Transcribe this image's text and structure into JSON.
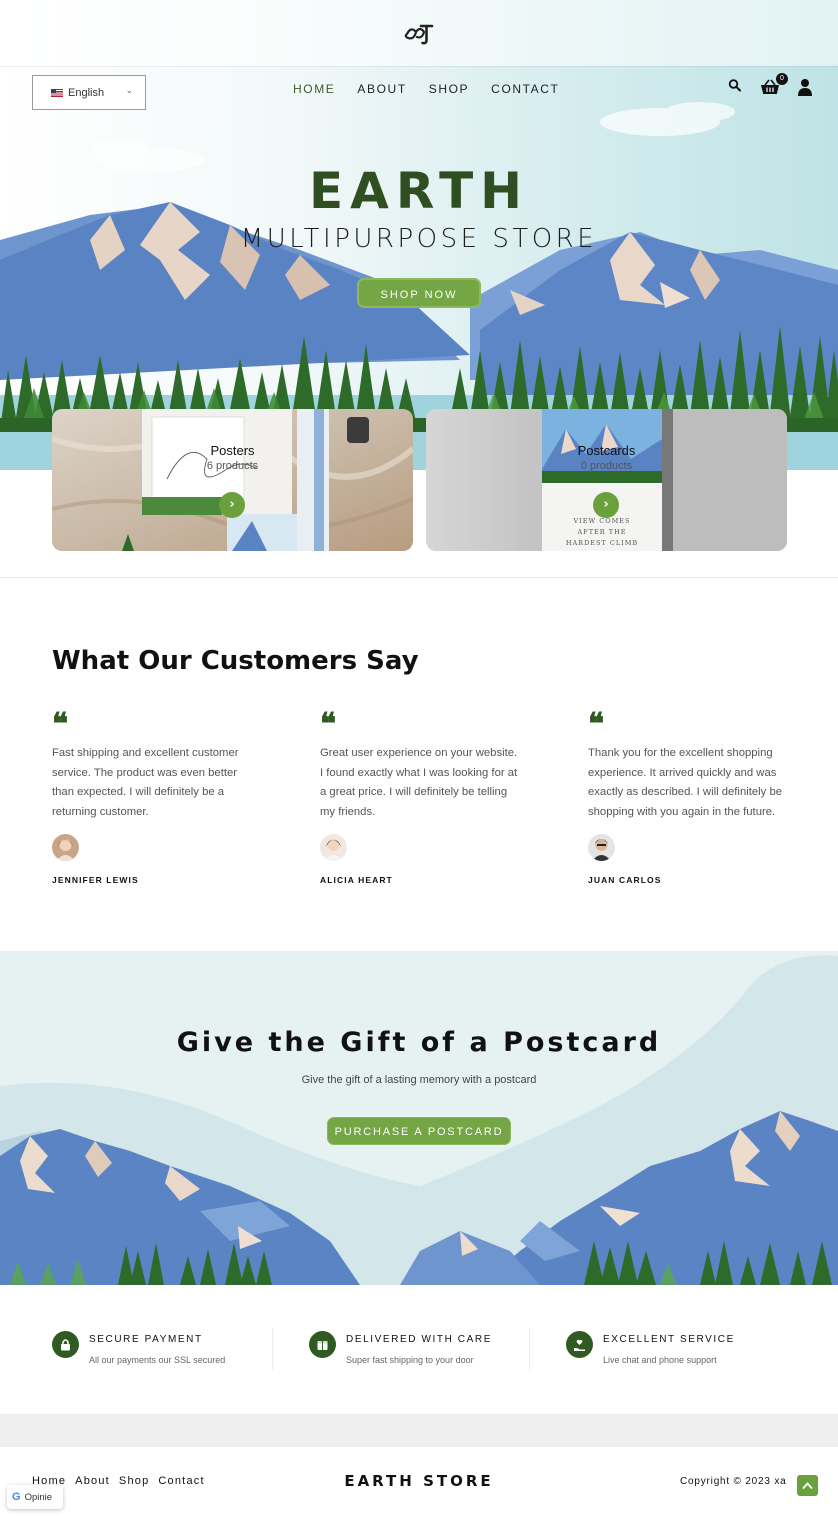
{
  "language_selector": {
    "value": "English"
  },
  "nav": {
    "items": [
      "HOME",
      "ABOUT",
      "SHOP",
      "CONTACT"
    ],
    "active": "HOME"
  },
  "cart": {
    "count": "0"
  },
  "hero": {
    "title": "EARTH",
    "subtitle": "MULTIPURPOSE STORE",
    "cta": "SHOP NOW"
  },
  "categories": [
    {
      "name": "Posters",
      "count": "6 products"
    },
    {
      "name": "Postcards",
      "count": "0 products"
    }
  ],
  "testimonials": {
    "title": "What Our Customers Say",
    "items": [
      {
        "text": "Fast shipping and excellent customer service. The product was even better than expected. I will definitely be a returning customer.",
        "name": "JENNIFER LEWIS"
      },
      {
        "text": "Great user experience on your website. I found exactly what I was looking for at a great price. I will definitely be telling my friends.",
        "name": "ALICIA HEART"
      },
      {
        "text": "Thank you for the excellent shopping experience. It arrived quickly and was exactly as described. I will definitely be shopping with you again in the future.",
        "name": "JUAN CARLOS"
      }
    ]
  },
  "gift": {
    "title": "Give the Gift of a Postcard",
    "subtitle": "Give the gift of a lasting memory with a postcard",
    "cta": "PURCHASE A POSTCARD"
  },
  "features": [
    {
      "title": "SECURE PAYMENT",
      "desc": "All our payments our SSL secured",
      "icon": "lock-icon"
    },
    {
      "title": "DELIVERED WITH CARE",
      "desc": "Super fast shipping to your door",
      "icon": "package-icon"
    },
    {
      "title": "EXCELLENT SERVICE",
      "desc": "Live chat and phone support",
      "icon": "support-icon"
    }
  ],
  "footer": {
    "nav": [
      "Home",
      "About",
      "Shop",
      "Contact"
    ],
    "brand": "EARTH STORE",
    "copyright": "Copyright © 2023 xa"
  },
  "reviews_widget": {
    "label": "Opinie",
    "logo_letter": "G"
  },
  "colors": {
    "brand_green": "#74a646",
    "dark_green": "#2f5a22",
    "title_green": "#2f4f22",
    "mountain_blue": "#5b84c4",
    "sky": "#cfe8ea"
  }
}
